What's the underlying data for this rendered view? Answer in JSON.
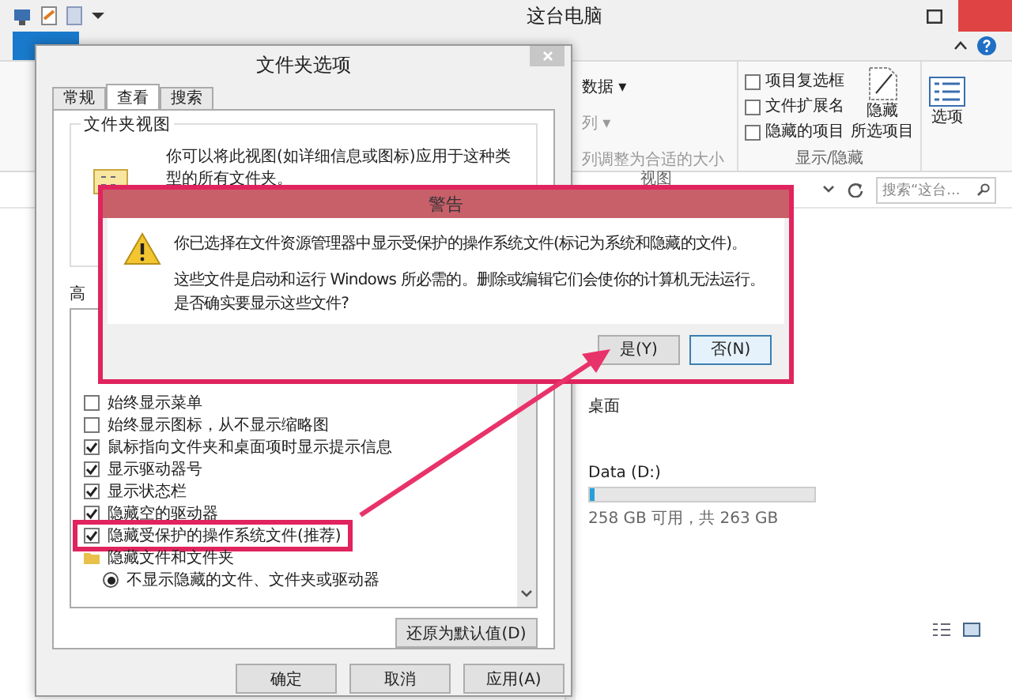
{
  "explorer": {
    "title": "这台电脑",
    "ribbon": {
      "layout_items": [
        {
          "label": "数据 ▾",
          "disabled": false
        },
        {
          "label": "列 ▾",
          "disabled": true
        },
        {
          "label": "列调整为合适的大小",
          "disabled": true
        }
      ],
      "layout_group_label": "视图",
      "checkboxes": [
        {
          "label": "项目复选框",
          "checked": false
        },
        {
          "label": "文件扩展名",
          "checked": false
        },
        {
          "label": "隐藏的项目",
          "checked": false
        }
      ],
      "hide_selected_button": [
        "隐藏",
        "所选项目"
      ],
      "show_hide_group_label": "显示/隐藏",
      "options_button": "选项"
    },
    "search": {
      "placeholder": "搜索“这台..."
    },
    "sections": [
      {
        "label": "桌面"
      }
    ],
    "drives": [
      {
        "name": "Data (D:)",
        "level": 0.02,
        "reading": "258 GB 可用，共 263 GB"
      }
    ]
  },
  "folder_options": {
    "title": "文件夹选项",
    "tabs": [
      {
        "label": "常规",
        "selected": false
      },
      {
        "label": "查看",
        "selected": true
      },
      {
        "label": "搜索",
        "selected": false
      }
    ],
    "folder_views": {
      "title": "文件夹视图",
      "description": "你可以将此视图(如详细信息或图标)应用于这种类型的所有文件夹。"
    },
    "advanced_label": "高",
    "settings": [
      {
        "kind": "checkbox",
        "label": "始终显示菜单",
        "checked": false,
        "highlighted": false
      },
      {
        "kind": "checkbox",
        "label": "始终显示图标，从不显示缩略图",
        "checked": false,
        "highlighted": false
      },
      {
        "kind": "checkbox",
        "label": "鼠标指向文件夹和桌面项时显示提示信息",
        "checked": true,
        "highlighted": false
      },
      {
        "kind": "checkbox",
        "label": "显示驱动器号",
        "checked": true,
        "highlighted": false
      },
      {
        "kind": "checkbox",
        "label": "显示状态栏",
        "checked": true,
        "highlighted": false
      },
      {
        "kind": "checkbox",
        "label": "隐藏空的驱动器",
        "checked": true,
        "highlighted": false
      },
      {
        "kind": "checkbox",
        "label": "隐藏受保护的操作系统文件(推荐)",
        "checked": true,
        "highlighted": true
      },
      {
        "kind": "folder",
        "label": "隐藏文件和文件夹",
        "highlighted": false
      },
      {
        "kind": "radio",
        "label": "不显示隐藏的文件、文件夹或驱动器",
        "checked": true,
        "highlighted": false
      }
    ],
    "restore_button": "还原为默认值(D)",
    "buttons": [
      {
        "label": "确定"
      },
      {
        "label": "取消"
      },
      {
        "label": "应用(A)"
      }
    ]
  },
  "warning": {
    "title": "警告",
    "paragraphs": [
      [
        "你已选择在文件资源管理器中显示受保护的操作系统文件(标记为系统和隐藏的文件)。"
      ],
      [
        "这些文件是启动和运行 Windows 所必需的。删除或编辑它们会使你的计算机无法运行。",
        "是否确实要显示这些文件?"
      ]
    ],
    "buttons": [
      {
        "label": "是(Y)",
        "focused": false
      },
      {
        "label": "否(N)",
        "focused": true
      }
    ]
  }
}
